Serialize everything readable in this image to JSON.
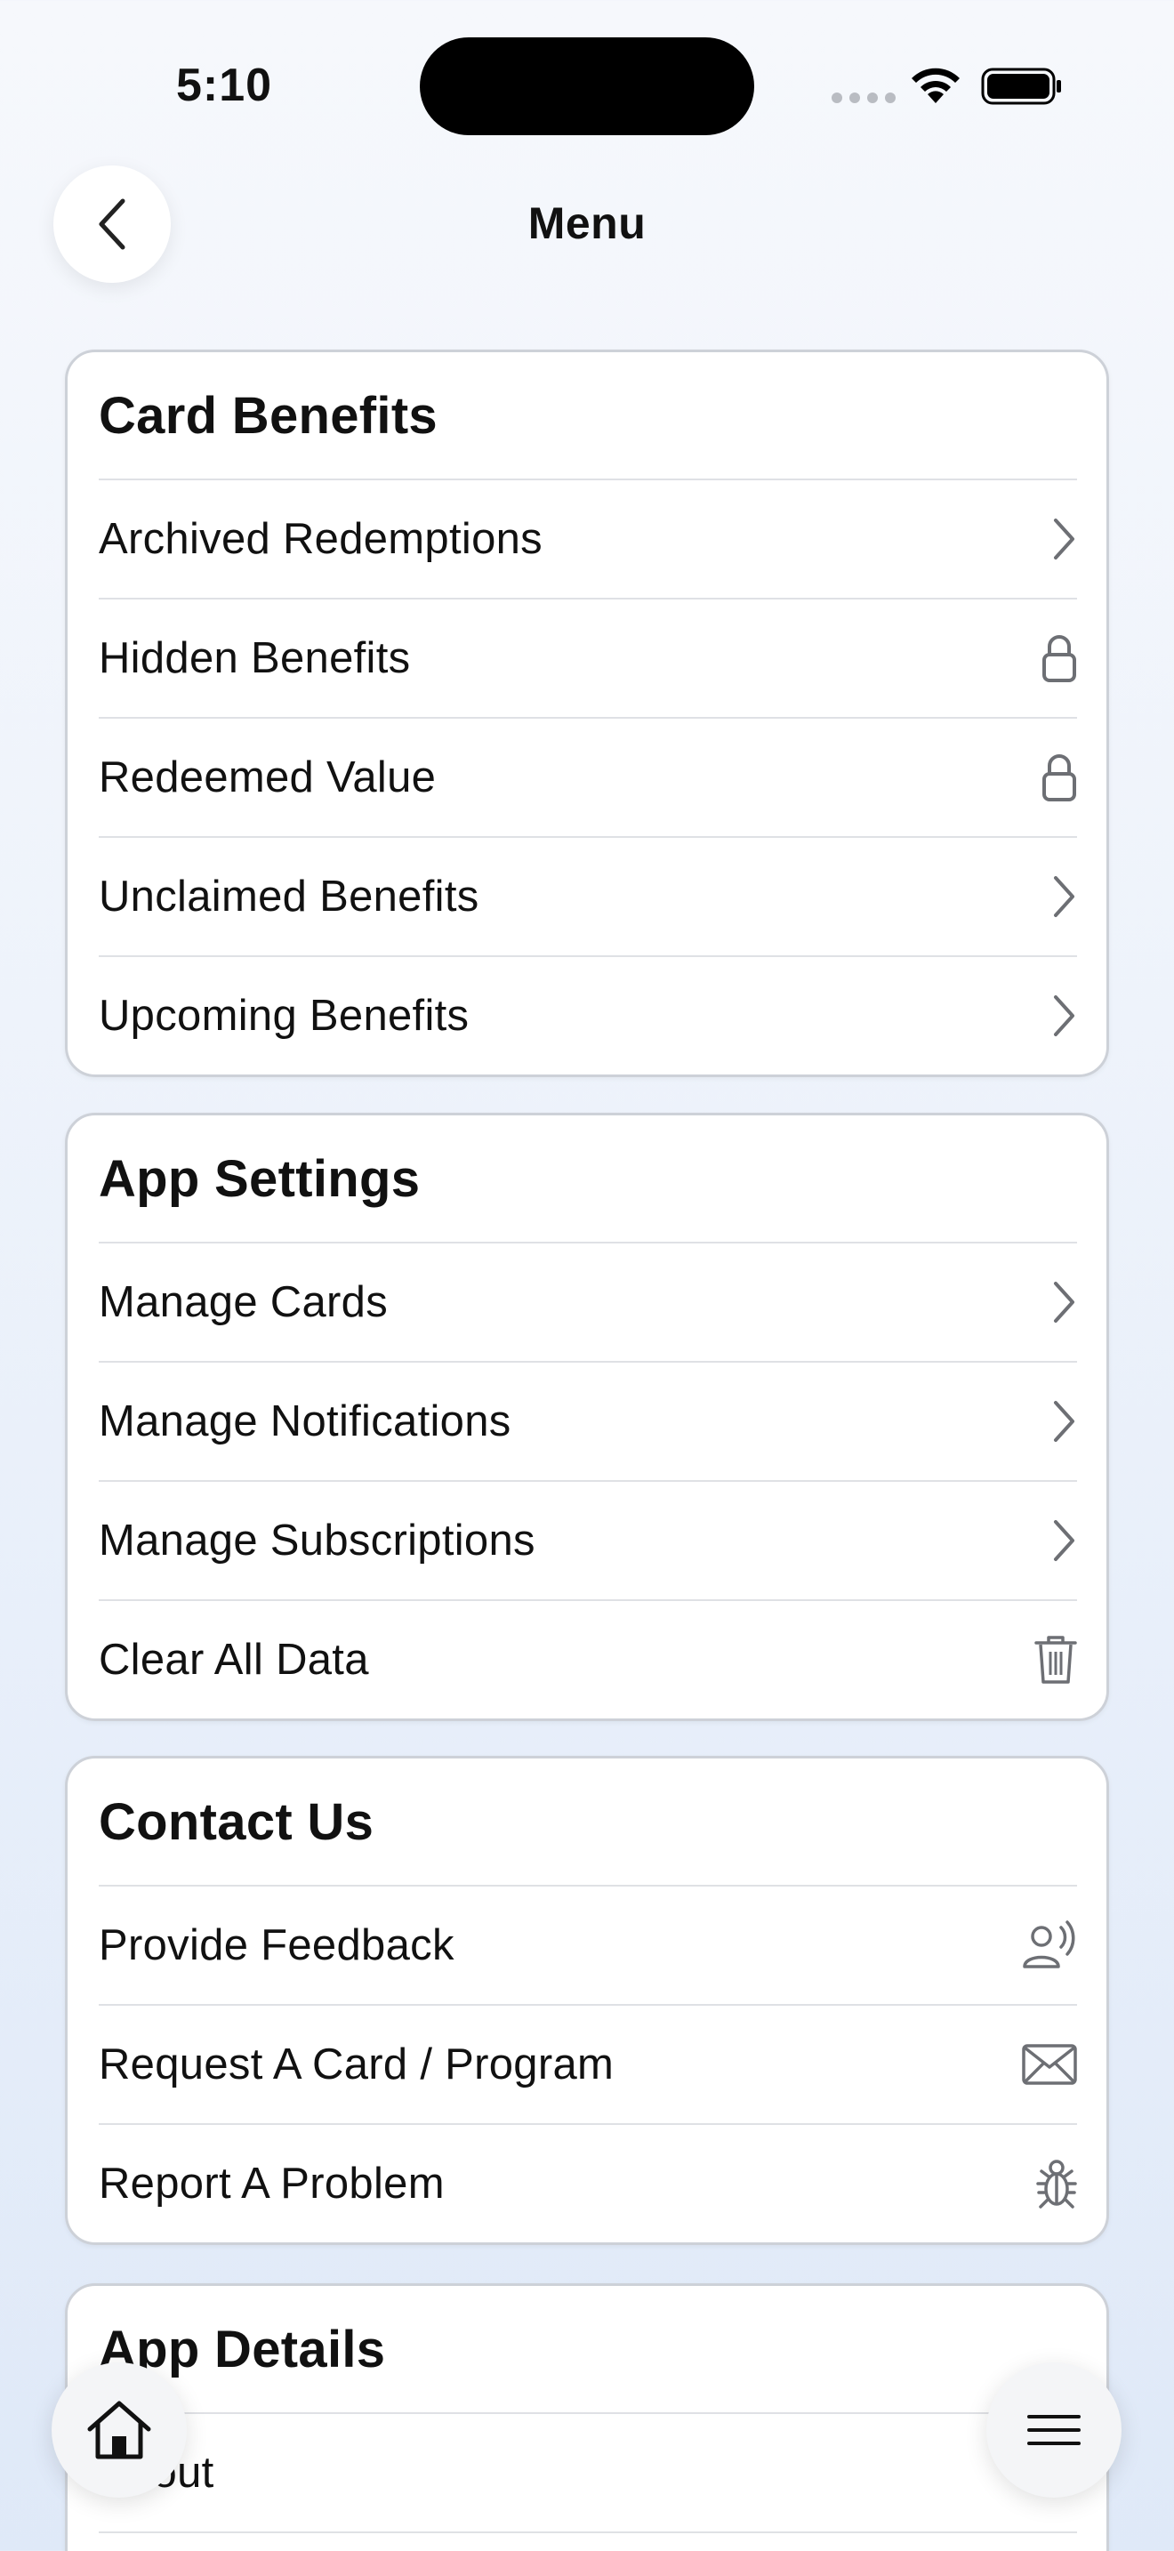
{
  "status": {
    "time": "5:10"
  },
  "header": {
    "title": "Menu"
  },
  "sections": [
    {
      "title": "Card Benefits",
      "items": [
        {
          "label": "Archived Redemptions",
          "icon": "chevron-right-icon"
        },
        {
          "label": "Hidden Benefits",
          "icon": "lock-icon"
        },
        {
          "label": "Redeemed Value",
          "icon": "lock-icon"
        },
        {
          "label": "Unclaimed Benefits",
          "icon": "chevron-right-icon"
        },
        {
          "label": "Upcoming Benefits",
          "icon": "chevron-right-icon"
        }
      ]
    },
    {
      "title": "App Settings",
      "items": [
        {
          "label": "Manage Cards",
          "icon": "chevron-right-icon"
        },
        {
          "label": "Manage Notifications",
          "icon": "chevron-right-icon"
        },
        {
          "label": "Manage Subscriptions",
          "icon": "chevron-right-icon"
        },
        {
          "label": "Clear All Data",
          "icon": "trash-icon"
        }
      ]
    },
    {
      "title": "Contact Us",
      "items": [
        {
          "label": "Provide Feedback",
          "icon": "person-speaking-icon"
        },
        {
          "label": "Request A Card / Program",
          "icon": "envelope-icon"
        },
        {
          "label": "Report A Problem",
          "icon": "bug-icon"
        }
      ]
    },
    {
      "title": "App Details",
      "items": [
        {
          "label": "About",
          "icon": "chevron-right-icon"
        }
      ]
    }
  ],
  "floating": {
    "home_icon": "house-icon",
    "menu_icon": "hamburger-icon"
  },
  "colors": {
    "icon": "#6d6f74",
    "divider": "#dfe1e5",
    "card_border": "#cdd1d8"
  }
}
